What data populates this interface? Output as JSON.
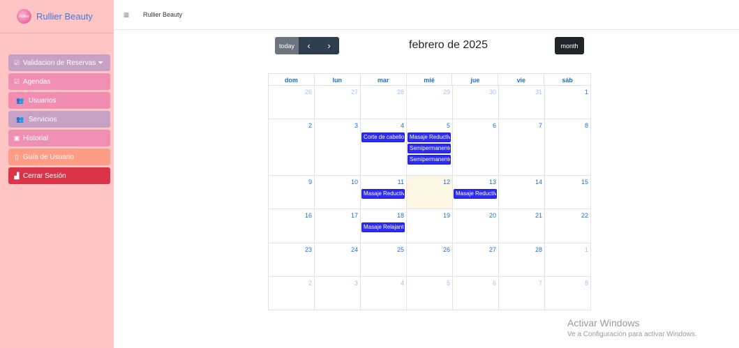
{
  "brand": {
    "name": "Rullier Beauty",
    "logo_text": "Rullier"
  },
  "sidebar": {
    "items": [
      {
        "label": "Validacion de Reservas ⏷",
        "icon": "clipboard-check-icon",
        "glyph": "☑",
        "cls": "c-lav"
      },
      {
        "label": "Agendas",
        "icon": "calendar-check-icon",
        "glyph": "☑",
        "cls": "c-pink"
      },
      {
        "label": "Usuarios",
        "icon": "users-icon",
        "glyph": "👥",
        "cls": "c-pink2 usr"
      },
      {
        "label": "Servicios",
        "icon": "users-icon",
        "glyph": "👥",
        "cls": "c-lav usr"
      },
      {
        "label": "Historial",
        "icon": "history-icon",
        "glyph": "▣",
        "cls": "c-pink"
      },
      {
        "label": "Guía de Usuario",
        "icon": "book-icon",
        "glyph": "▯",
        "cls": "c-orange"
      },
      {
        "label": "Cerrar Sesión",
        "icon": "door-exit-icon",
        "glyph": "▟",
        "cls": "c-red"
      }
    ]
  },
  "topbar": {
    "title": "Rullier Beauty",
    "menu_icon": "hamburger-icon"
  },
  "calendar": {
    "today_label": "today",
    "prev_label": "‹",
    "next_label": "›",
    "title": "febrero de 2025",
    "month_label": "month",
    "weekdays": [
      "dom",
      "lun",
      "mar",
      "mié",
      "jue",
      "vie",
      "sáb"
    ],
    "weeks": [
      {
        "days": [
          {
            "n": "26",
            "other": true
          },
          {
            "n": "27",
            "other": true
          },
          {
            "n": "28",
            "other": true
          },
          {
            "n": "29",
            "other": true
          },
          {
            "n": "30",
            "other": true
          },
          {
            "n": "31",
            "other": true
          },
          {
            "n": "1"
          }
        ]
      },
      {
        "days": [
          {
            "n": "2"
          },
          {
            "n": "3"
          },
          {
            "n": "4",
            "events": [
              "Corte de cabello"
            ]
          },
          {
            "n": "5",
            "events": [
              "Masaje Reductivo",
              "Semipermanente",
              "Semipermanente"
            ]
          },
          {
            "n": "6"
          },
          {
            "n": "7"
          },
          {
            "n": "8"
          }
        ]
      },
      {
        "days": [
          {
            "n": "9"
          },
          {
            "n": "10"
          },
          {
            "n": "11",
            "events": [
              "Masaje Reductivo"
            ]
          },
          {
            "n": "12",
            "today": true
          },
          {
            "n": "13",
            "events": [
              "Masaje Reductivo"
            ]
          },
          {
            "n": "14"
          },
          {
            "n": "15"
          }
        ]
      },
      {
        "days": [
          {
            "n": "16"
          },
          {
            "n": "17"
          },
          {
            "n": "18",
            "events": [
              "Masaje Relajante"
            ]
          },
          {
            "n": "19"
          },
          {
            "n": "20"
          },
          {
            "n": "21"
          },
          {
            "n": "22"
          }
        ]
      },
      {
        "days": [
          {
            "n": "23"
          },
          {
            "n": "24"
          },
          {
            "n": "25"
          },
          {
            "n": "26"
          },
          {
            "n": "27"
          },
          {
            "n": "28"
          },
          {
            "n": "1",
            "other": true
          }
        ]
      },
      {
        "days": [
          {
            "n": "2",
            "other": true
          },
          {
            "n": "3",
            "other": true
          },
          {
            "n": "4",
            "other": true
          },
          {
            "n": "5",
            "other": true
          },
          {
            "n": "6",
            "other": true
          },
          {
            "n": "7",
            "other": true
          },
          {
            "n": "8",
            "other": true
          }
        ]
      }
    ]
  },
  "watermark": {
    "line1": "Activar Windows",
    "line2": "Ve a Configuración para activar Windows."
  },
  "colors": {
    "sidebar_bg": "#ffc5c5",
    "event_bg": "#2b2bf5",
    "today_bg": "#fcf8e3",
    "link_blue": "#1a6fd6"
  }
}
